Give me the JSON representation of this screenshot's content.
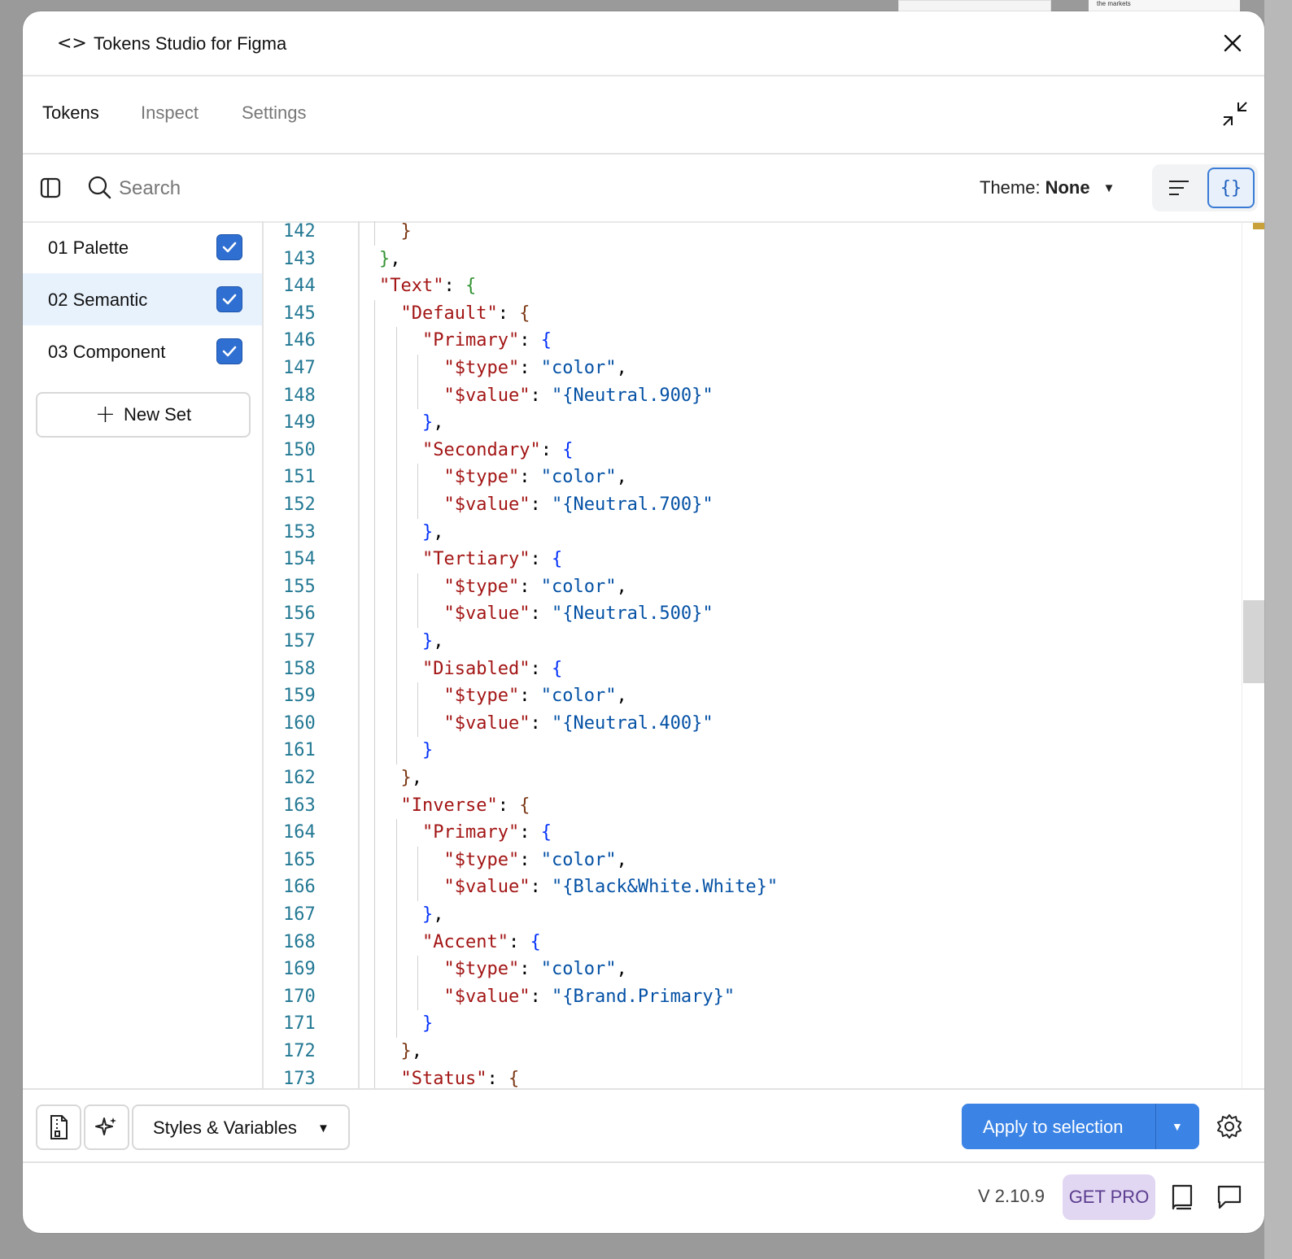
{
  "app": {
    "title": "Tokens Studio for Figma"
  },
  "tabs": [
    {
      "label": "Tokens",
      "active": true
    },
    {
      "label": "Inspect",
      "active": false
    },
    {
      "label": "Settings",
      "active": false
    }
  ],
  "toolbar": {
    "search_placeholder": "Search",
    "theme_label": "Theme:",
    "theme_value": "None"
  },
  "sidebar": {
    "sets": [
      {
        "label": "01 Palette",
        "checked": true,
        "selected": false
      },
      {
        "label": "02 Semantic",
        "checked": true,
        "selected": true
      },
      {
        "label": "03 Component",
        "checked": true,
        "selected": false
      }
    ],
    "new_set_label": "New Set"
  },
  "editor": {
    "lines": [
      {
        "n": "142",
        "indent": 2,
        "parts": [
          [
            "b2",
            "}"
          ]
        ]
      },
      {
        "n": "143",
        "indent": 1,
        "parts": [
          [
            "b1",
            "}"
          ],
          [
            "p",
            ","
          ]
        ]
      },
      {
        "n": "144",
        "indent": 1,
        "parts": [
          [
            "k",
            "\"Text\""
          ],
          [
            "p",
            ": "
          ],
          [
            "b1",
            "{"
          ]
        ]
      },
      {
        "n": "145",
        "indent": 2,
        "parts": [
          [
            "k",
            "\"Default\""
          ],
          [
            "p",
            ": "
          ],
          [
            "b2",
            "{"
          ]
        ]
      },
      {
        "n": "146",
        "indent": 3,
        "parts": [
          [
            "k",
            "\"Primary\""
          ],
          [
            "p",
            ": "
          ],
          [
            "b3",
            "{"
          ]
        ]
      },
      {
        "n": "147",
        "indent": 4,
        "parts": [
          [
            "k",
            "\"$type\""
          ],
          [
            "p",
            ": "
          ],
          [
            "s",
            "\"color\""
          ],
          [
            "p",
            ","
          ]
        ]
      },
      {
        "n": "148",
        "indent": 4,
        "parts": [
          [
            "k",
            "\"$value\""
          ],
          [
            "p",
            ": "
          ],
          [
            "s",
            "\"{Neutral.900}\""
          ]
        ]
      },
      {
        "n": "149",
        "indent": 3,
        "parts": [
          [
            "b3",
            "}"
          ],
          [
            "p",
            ","
          ]
        ]
      },
      {
        "n": "150",
        "indent": 3,
        "parts": [
          [
            "k",
            "\"Secondary\""
          ],
          [
            "p",
            ": "
          ],
          [
            "b3",
            "{"
          ]
        ]
      },
      {
        "n": "151",
        "indent": 4,
        "parts": [
          [
            "k",
            "\"$type\""
          ],
          [
            "p",
            ": "
          ],
          [
            "s",
            "\"color\""
          ],
          [
            "p",
            ","
          ]
        ]
      },
      {
        "n": "152",
        "indent": 4,
        "parts": [
          [
            "k",
            "\"$value\""
          ],
          [
            "p",
            ": "
          ],
          [
            "s",
            "\"{Neutral.700}\""
          ]
        ]
      },
      {
        "n": "153",
        "indent": 3,
        "parts": [
          [
            "b3",
            "}"
          ],
          [
            "p",
            ","
          ]
        ]
      },
      {
        "n": "154",
        "indent": 3,
        "parts": [
          [
            "k",
            "\"Tertiary\""
          ],
          [
            "p",
            ": "
          ],
          [
            "b3",
            "{"
          ]
        ]
      },
      {
        "n": "155",
        "indent": 4,
        "parts": [
          [
            "k",
            "\"$type\""
          ],
          [
            "p",
            ": "
          ],
          [
            "s",
            "\"color\""
          ],
          [
            "p",
            ","
          ]
        ]
      },
      {
        "n": "156",
        "indent": 4,
        "parts": [
          [
            "k",
            "\"$value\""
          ],
          [
            "p",
            ": "
          ],
          [
            "s",
            "\"{Neutral.500}\""
          ]
        ]
      },
      {
        "n": "157",
        "indent": 3,
        "parts": [
          [
            "b3",
            "}"
          ],
          [
            "p",
            ","
          ]
        ]
      },
      {
        "n": "158",
        "indent": 3,
        "parts": [
          [
            "k",
            "\"Disabled\""
          ],
          [
            "p",
            ": "
          ],
          [
            "b3",
            "{"
          ]
        ]
      },
      {
        "n": "159",
        "indent": 4,
        "parts": [
          [
            "k",
            "\"$type\""
          ],
          [
            "p",
            ": "
          ],
          [
            "s",
            "\"color\""
          ],
          [
            "p",
            ","
          ]
        ]
      },
      {
        "n": "160",
        "indent": 4,
        "parts": [
          [
            "k",
            "\"$value\""
          ],
          [
            "p",
            ": "
          ],
          [
            "s",
            "\"{Neutral.400}\""
          ]
        ]
      },
      {
        "n": "161",
        "indent": 3,
        "parts": [
          [
            "b3",
            "}"
          ]
        ]
      },
      {
        "n": "162",
        "indent": 2,
        "parts": [
          [
            "b2",
            "}"
          ],
          [
            "p",
            ","
          ]
        ]
      },
      {
        "n": "163",
        "indent": 2,
        "parts": [
          [
            "k",
            "\"Inverse\""
          ],
          [
            "p",
            ": "
          ],
          [
            "b2",
            "{"
          ]
        ]
      },
      {
        "n": "164",
        "indent": 3,
        "parts": [
          [
            "k",
            "\"Primary\""
          ],
          [
            "p",
            ": "
          ],
          [
            "b3",
            "{"
          ]
        ]
      },
      {
        "n": "165",
        "indent": 4,
        "parts": [
          [
            "k",
            "\"$type\""
          ],
          [
            "p",
            ": "
          ],
          [
            "s",
            "\"color\""
          ],
          [
            "p",
            ","
          ]
        ]
      },
      {
        "n": "166",
        "indent": 4,
        "parts": [
          [
            "k",
            "\"$value\""
          ],
          [
            "p",
            ": "
          ],
          [
            "s",
            "\"{Black&White.White}\""
          ]
        ]
      },
      {
        "n": "167",
        "indent": 3,
        "parts": [
          [
            "b3",
            "}"
          ],
          [
            "p",
            ","
          ]
        ]
      },
      {
        "n": "168",
        "indent": 3,
        "parts": [
          [
            "k",
            "\"Accent\""
          ],
          [
            "p",
            ": "
          ],
          [
            "b3",
            "{"
          ]
        ]
      },
      {
        "n": "169",
        "indent": 4,
        "parts": [
          [
            "k",
            "\"$type\""
          ],
          [
            "p",
            ": "
          ],
          [
            "s",
            "\"color\""
          ],
          [
            "p",
            ","
          ]
        ]
      },
      {
        "n": "170",
        "indent": 4,
        "parts": [
          [
            "k",
            "\"$value\""
          ],
          [
            "p",
            ": "
          ],
          [
            "s",
            "\"{Brand.Primary}\""
          ]
        ]
      },
      {
        "n": "171",
        "indent": 3,
        "parts": [
          [
            "b3",
            "}"
          ]
        ]
      },
      {
        "n": "172",
        "indent": 2,
        "parts": [
          [
            "b2",
            "}"
          ],
          [
            "p",
            ","
          ]
        ]
      },
      {
        "n": "173",
        "indent": 2,
        "parts": [
          [
            "k",
            "\"Status\""
          ],
          [
            "p",
            ": "
          ],
          [
            "b2",
            "{"
          ]
        ]
      }
    ]
  },
  "bottombar": {
    "styles_dropdown_label": "Styles & Variables",
    "apply_label": "Apply to selection"
  },
  "footer": {
    "version": "V 2.10.9",
    "get_pro_label": "GET PRO"
  },
  "background": {
    "card_text": "the markets"
  },
  "colors": {
    "accent": "#3b84e6",
    "checkbox": "#2f6fd1",
    "selected_row": "#e8f2fd",
    "get_pro_bg": "#e1d7f2"
  }
}
